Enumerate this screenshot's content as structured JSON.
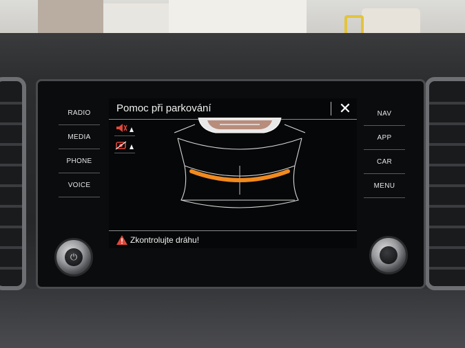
{
  "left_menu": {
    "items": [
      "RADIO",
      "MEDIA",
      "PHONE",
      "VOICE"
    ]
  },
  "right_menu": {
    "items": [
      "NAV",
      "APP",
      "CAR",
      "MENU"
    ]
  },
  "screen": {
    "title": "Pomoc při parkování",
    "close_glyph": "✕",
    "warning_text": "Zkontrolujte dráhu!"
  },
  "icons": {
    "sound": "speaker-mute-icon",
    "camera": "rear-camera-icon",
    "warning": "warning-triangle-icon",
    "power": "power-icon"
  },
  "colors": {
    "accent": "#f28a1f",
    "warning": "#e0473a",
    "text": "#f0f0f0"
  }
}
